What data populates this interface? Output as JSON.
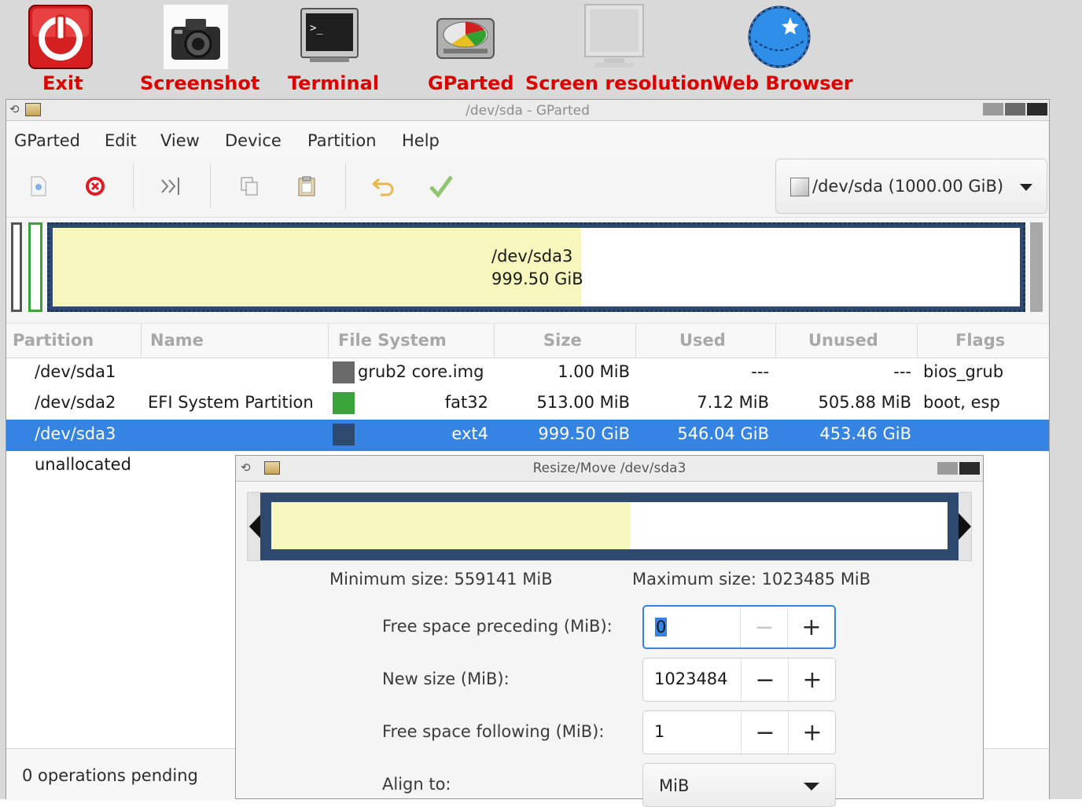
{
  "desktop": {
    "icons": [
      {
        "label": "Exit",
        "icon": "power-icon"
      },
      {
        "label": "Screenshot",
        "icon": "camera-icon"
      },
      {
        "label": "Terminal",
        "icon": "terminal-icon"
      },
      {
        "label": "GParted",
        "icon": "gparted-icon"
      },
      {
        "label": "Screen resolution",
        "icon": "monitor-icon"
      },
      {
        "label": "Web Browser",
        "icon": "globe-icon"
      }
    ],
    "label_color": "#e00000"
  },
  "window": {
    "title": "/dev/sda - GParted",
    "menu": [
      "GParted",
      "Edit",
      "View",
      "Device",
      "Partition",
      "Help"
    ],
    "toolbar": [
      {
        "icon": "new-partition-icon"
      },
      {
        "icon": "delete-icon"
      },
      {
        "icon": "resize-move-icon"
      },
      {
        "icon": "copy-icon"
      },
      {
        "icon": "paste-icon"
      },
      {
        "icon": "undo-icon"
      },
      {
        "icon": "apply-icon"
      }
    ],
    "device_selector": "/dev/sda (1000.00 GiB)",
    "disk_map": {
      "label": "/dev/sda3",
      "size": "999.50 GiB",
      "used_fraction": 0.546
    },
    "columns": [
      "Partition",
      "Name",
      "File System",
      "Size",
      "Used",
      "Unused",
      "Flags"
    ],
    "rows": [
      {
        "partition": "/dev/sda1",
        "name": "",
        "fs": "grub2 core.img",
        "fs_color": "#6a6a6a",
        "size": "1.00 MiB",
        "used": "---",
        "unused": "---",
        "flags": "bios_grub"
      },
      {
        "partition": "/dev/sda2",
        "name": "EFI System Partition",
        "fs": "fat32",
        "fs_color": "#3aa33a",
        "size": "513.00 MiB",
        "used": "7.12 MiB",
        "unused": "505.88 MiB",
        "flags": "boot, esp"
      },
      {
        "partition": "/dev/sda3",
        "name": "",
        "fs": "ext4",
        "fs_color": "#2e4a6f",
        "size": "999.50 GiB",
        "used": "546.04 GiB",
        "unused": "453.46 GiB",
        "flags": ""
      },
      {
        "partition": "unallocated",
        "name": "",
        "fs": "",
        "fs_color": "",
        "size": "",
        "used": "",
        "unused": "",
        "flags": ""
      }
    ],
    "status": "0 operations pending",
    "accent": "#3584e4"
  },
  "dialog": {
    "title": "Resize/Move /dev/sda3",
    "used_fraction": 0.53,
    "min_size": "Minimum size: 559141 MiB",
    "max_size": "Maximum size: 1023485 MiB",
    "fields": [
      {
        "label": "Free space preceding (MiB):",
        "value": "0"
      },
      {
        "label": "New size (MiB):",
        "value": "1023484"
      },
      {
        "label": "Free space following (MiB):",
        "value": "1"
      }
    ],
    "align_label": "Align to:",
    "align_value": "MiB"
  }
}
